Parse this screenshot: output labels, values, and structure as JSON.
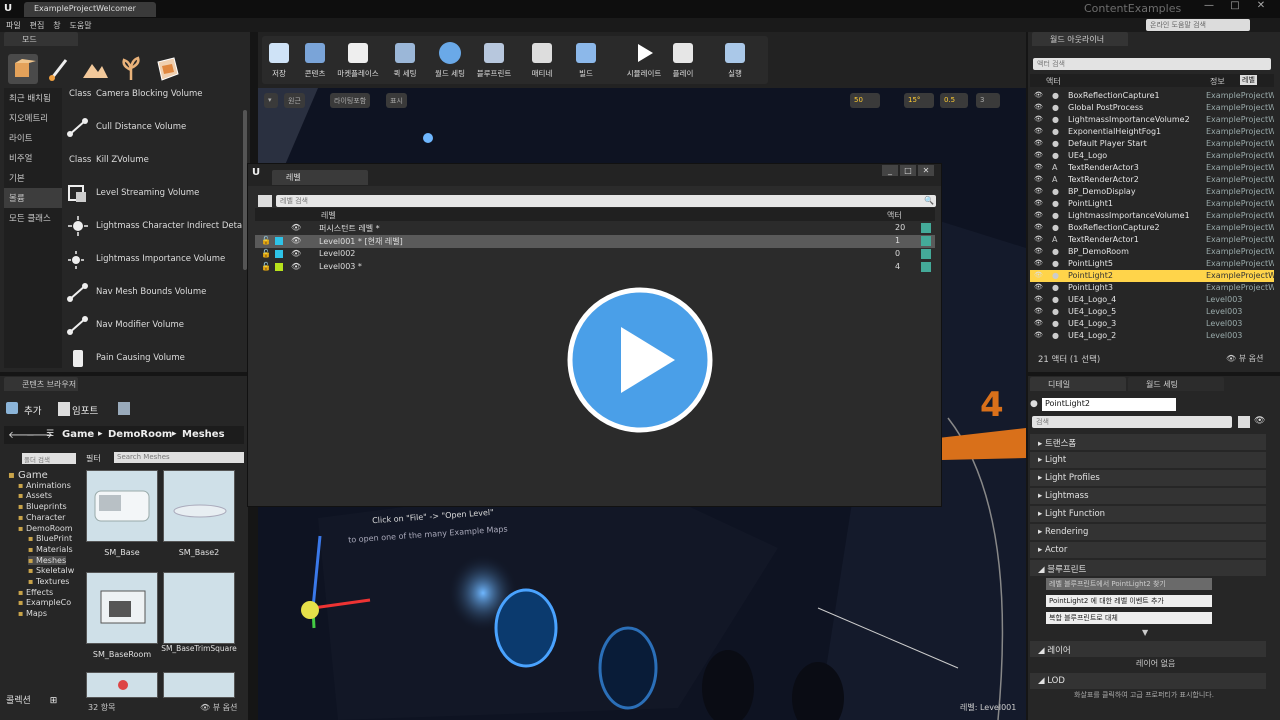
{
  "window": {
    "doc_tab": "ExampleProjectWelcomer",
    "app_name": "ContentExamples",
    "search_help": "온라인 도움말 검색",
    "controls": [
      "—",
      "□",
      "✕"
    ]
  },
  "menu": [
    "파일",
    "편집",
    "창",
    "도움말"
  ],
  "modes": {
    "tab": "모드",
    "categories": [
      "최근 배치됨",
      "지오메트리",
      "라이트",
      "비주얼",
      "기본",
      "볼륨",
      "모든 클래스"
    ],
    "selected_category": "볼륨",
    "items": [
      {
        "label": "Camera Blocking Volume",
        "tag": "Class"
      },
      {
        "label": "Cull Distance Volume",
        "tag": ""
      },
      {
        "label": "Kill ZVolume",
        "tag": "Class"
      },
      {
        "label": "Level Streaming Volume",
        "tag": ""
      },
      {
        "label": "Lightmass Character Indirect Detail V",
        "tag": ""
      },
      {
        "label": "Lightmass Importance Volume",
        "tag": ""
      },
      {
        "label": "Nav Mesh Bounds Volume",
        "tag": ""
      },
      {
        "label": "Nav Modifier Volume",
        "tag": ""
      },
      {
        "label": "Pain Causing Volume",
        "tag": ""
      }
    ]
  },
  "toolbar": {
    "buttons": [
      "저장",
      "콘텐츠",
      "마켓플레이스",
      "퀵 세팅",
      "월드 세팅",
      "블루프린트",
      "매티네",
      "빌드",
      "시뮬레이트",
      "플레이",
      "실행"
    ]
  },
  "viewport": {
    "top_buttons": [
      "원근",
      "라이팅포함",
      "표시"
    ],
    "numbers": [
      "50",
      "15°",
      "0.5",
      "3"
    ],
    "hint_line1": "Click on \"File\" -> \"Open Level\"",
    "hint_line2": "to open one of the many Example Maps",
    "level_label": "레벨:  Level001"
  },
  "levels": {
    "tab": "레벨",
    "search_placeholder": "레벨 검색",
    "header_name": "레벨",
    "header_count": "액터",
    "rows": [
      {
        "name": "퍼시스턴트 레벨 *",
        "count": "20",
        "color": "",
        "selected": false
      },
      {
        "name": "Level001 * [현재 레벨]",
        "count": "1",
        "color": "#2ec3e8",
        "selected": true
      },
      {
        "name": "Level002",
        "count": "0",
        "color": "#2ec3e8",
        "selected": false
      },
      {
        "name": "Level003 *",
        "count": "4",
        "color": "#b7e21c",
        "selected": false
      }
    ]
  },
  "outliner": {
    "tab": "월드 아웃라이너",
    "search_placeholder": "액터 검색",
    "col_label": "액터",
    "col_type": "정보",
    "col_type_select": "레벨",
    "rows": [
      {
        "icon": "●",
        "name": "BoxReflectionCapture1",
        "level": "ExampleProjectWe"
      },
      {
        "icon": "●",
        "name": "Global PostProcess",
        "level": "ExampleProjectWe"
      },
      {
        "icon": "●",
        "name": "LightmassImportanceVolume2",
        "level": "ExampleProjectWe"
      },
      {
        "icon": "●",
        "name": "ExponentialHeightFog1",
        "level": "ExampleProjectWe"
      },
      {
        "icon": "●",
        "name": "Default Player Start",
        "level": "ExampleProjectWe"
      },
      {
        "icon": "●",
        "name": "UE4_Logo",
        "level": "ExampleProjectWe"
      },
      {
        "icon": "A",
        "name": "TextRenderActor3",
        "level": "ExampleProjectWe"
      },
      {
        "icon": "A",
        "name": "TextRenderActor2",
        "level": "ExampleProjectWe"
      },
      {
        "icon": "●",
        "name": "BP_DemoDisplay",
        "level": "ExampleProjectWe"
      },
      {
        "icon": "●",
        "name": "PointLight1",
        "level": "ExampleProjectWe"
      },
      {
        "icon": "●",
        "name": "LightmassImportanceVolume1",
        "level": "ExampleProjectWe"
      },
      {
        "icon": "●",
        "name": "BoxReflectionCapture2",
        "level": "ExampleProjectWe"
      },
      {
        "icon": "A",
        "name": "TextRenderActor1",
        "level": "ExampleProjectWe"
      },
      {
        "icon": "●",
        "name": "BP_DemoRoom",
        "level": "ExampleProjectWe"
      },
      {
        "icon": "●",
        "name": "PointLight5",
        "level": "ExampleProjectWe"
      },
      {
        "icon": "●",
        "name": "PointLight2",
        "level": "ExampleProjectWe"
      },
      {
        "icon": "●",
        "name": "PointLight3",
        "level": "ExampleProjectWe"
      },
      {
        "icon": "●",
        "name": "UE4_Logo_4",
        "level": "Level003"
      },
      {
        "icon": "●",
        "name": "UE4_Logo_5",
        "level": "Level003"
      },
      {
        "icon": "●",
        "name": "UE4_Logo_3",
        "level": "Level003"
      },
      {
        "icon": "●",
        "name": "UE4_Logo_2",
        "level": "Level003"
      }
    ],
    "selected_row": "PointLight2",
    "count": "21 액터 (1 선택)",
    "view_options": "뷰 옵션"
  },
  "details": {
    "tab1": "디테일",
    "tab2": "월드 세팅",
    "name_value": "PointLight2",
    "search_placeholder": "검색",
    "categories": [
      "트랜스폼",
      "Light",
      "Light Profiles",
      "Lightmass",
      "Light Function",
      "Rendering",
      "Actor",
      "블루프린트"
    ],
    "blueprint_buttons": [
      "레벨 블루프린트에서 PointLight2 찾기",
      "PointLight2 에 대한 레벨 이벤트 추가",
      "복합 블루프린트로 대체"
    ],
    "layers_label": "레이어",
    "layers_empty": "레이어 없음",
    "lod_label": "LOD",
    "lod_hint": "화살표를 클릭하여 고급 프로퍼티가 표시합니다."
  },
  "content_browser": {
    "tab": "콘텐츠 브라우저",
    "add_label": "추가",
    "import_label": "임포트",
    "path": [
      "Game",
      "DemoRoom",
      "Meshes"
    ],
    "folder_search_placeholder": "폴더 검색",
    "filter_label": "필터",
    "search_placeholder": "Search Meshes",
    "tree": [
      {
        "name": "Game",
        "depth": 0
      },
      {
        "name": "Animations",
        "depth": 1
      },
      {
        "name": "Assets",
        "depth": 1
      },
      {
        "name": "Blueprints",
        "depth": 1
      },
      {
        "name": "Character",
        "depth": 1
      },
      {
        "name": "DemoRoom",
        "depth": 1
      },
      {
        "name": "BluePrint",
        "depth": 2
      },
      {
        "name": "Materials",
        "depth": 2
      },
      {
        "name": "Meshes",
        "depth": 2
      },
      {
        "name": "Skeletalw",
        "depth": 2
      },
      {
        "name": "Textures",
        "depth": 2
      },
      {
        "name": "Effects",
        "depth": 1
      },
      {
        "name": "ExampleCo",
        "depth": 1
      },
      {
        "name": "Maps",
        "depth": 1
      }
    ],
    "selected_tree": "Meshes",
    "assets": [
      {
        "label": "SM_Base"
      },
      {
        "label": "SM_Base2"
      },
      {
        "label": "SM_BaseRoom"
      },
      {
        "label": "SM_BaseTrimSquare"
      },
      {
        "label": ""
      },
      {
        "label": ""
      }
    ],
    "count": "32 항목",
    "view_options": "뷰 옵션",
    "collections": "콜렉션"
  },
  "colors": {
    "accent_blue": "#4a9fe8",
    "selection_yellow": "#ffd44a",
    "level_cyan": "#2ec3e8",
    "level_green": "#b7e21c"
  }
}
